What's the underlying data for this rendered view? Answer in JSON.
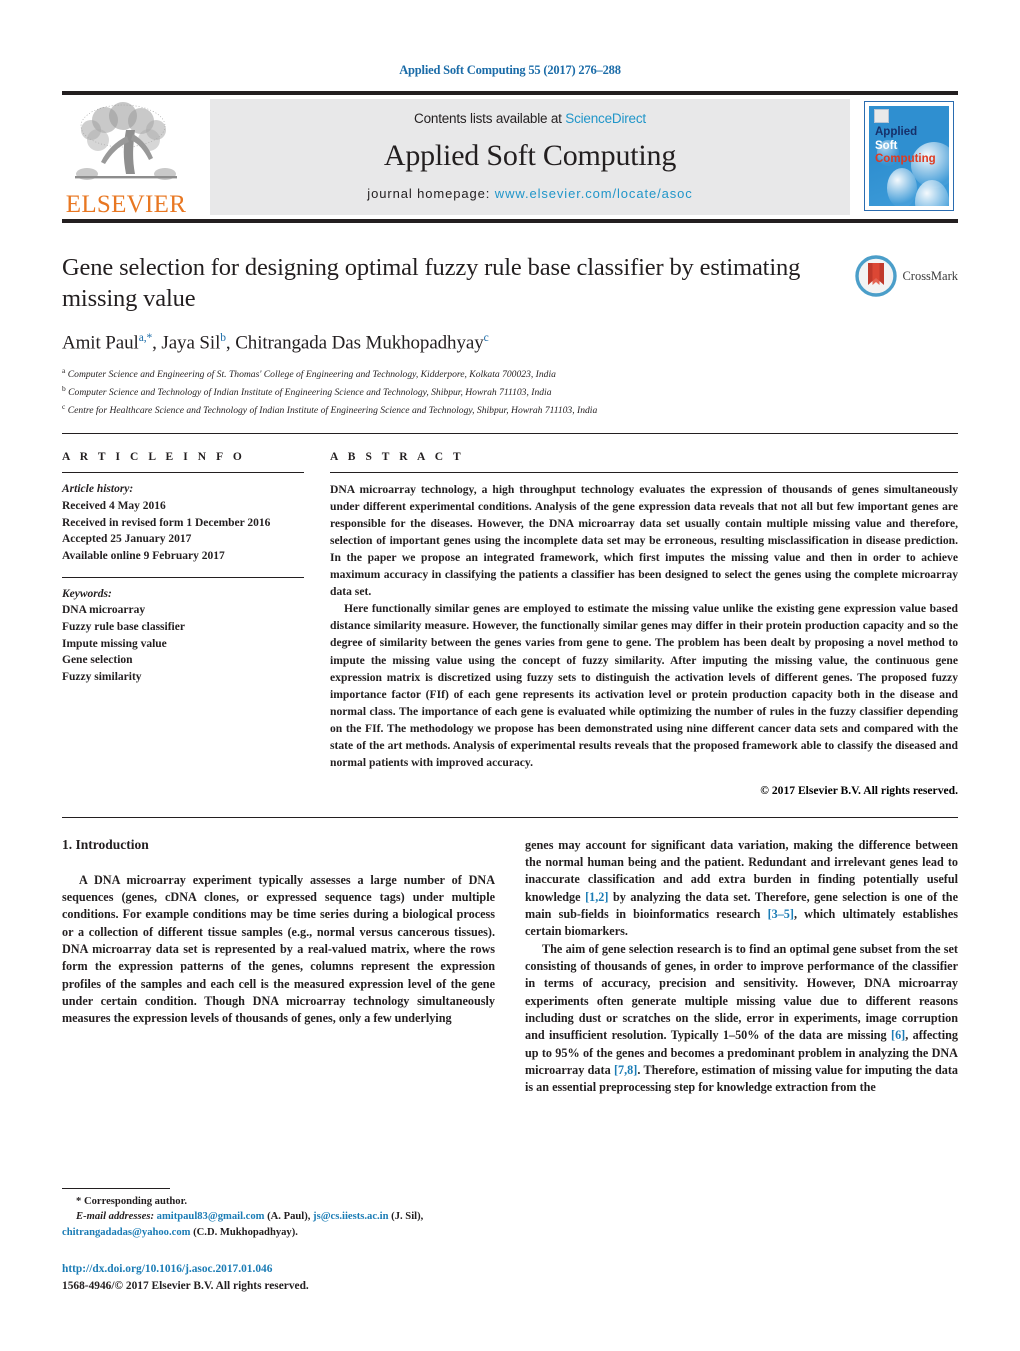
{
  "running_head": "Applied Soft Computing 55 (2017) 276–288",
  "masthead": {
    "publisher": "ELSEVIER",
    "contents_prefix": "Contents lists available at ",
    "contents_link": "ScienceDirect",
    "journal_name": "Applied Soft Computing",
    "homepage_prefix": "journal homepage: ",
    "homepage_url": "www.elsevier.com/locate/asoc",
    "cover": {
      "line1": "Applied",
      "line2": "Soft",
      "line3": "Computing"
    },
    "accent_blue": "#2196c9",
    "elsevier_orange": "#e87722"
  },
  "article": {
    "title": "Gene selection for designing optimal fuzzy rule base classifier by estimating missing value",
    "authors_html": "Amit Paul<sup>a,*</sup>, Jaya Sil<sup>b</sup>, Chitrangada Das Mukhopadhyay<sup>c</sup>",
    "affiliations": [
      {
        "marker": "a",
        "text": "Computer Science and Engineering of St. Thomas' College of Engineering and Technology, Kidderpore, Kolkata 700023, India"
      },
      {
        "marker": "b",
        "text": "Computer Science and Technology of Indian Institute of Engineering Science and Technology, Shibpur, Howrah 711103, India"
      },
      {
        "marker": "c",
        "text": "Centre for Healthcare Science and Technology of Indian Institute of Engineering Science and Technology, Shibpur, Howrah 711103, India"
      }
    ],
    "crossmark_label": "CrossMark"
  },
  "article_info": {
    "heading": "A R T I C L E   I N F O",
    "history_label": "Article history:",
    "history": [
      "Received 4 May 2016",
      "Received in revised form 1 December 2016",
      "Accepted 25 January 2017",
      "Available online 9 February 2017"
    ],
    "keywords_label": "Keywords:",
    "keywords": [
      "DNA microarray",
      "Fuzzy rule base classifier",
      "Impute missing value",
      "Gene selection",
      "Fuzzy similarity"
    ]
  },
  "abstract": {
    "heading": "A B S T R A C T",
    "paragraphs": [
      "DNA microarray technology, a high throughput technology evaluates the expression of thousands of genes simultaneously under different experimental conditions. Analysis of the gene expression data reveals that not all but few important genes are responsible for the diseases. However, the DNA microarray data set usually contain multiple missing value and therefore, selection of important genes using the incomplete data set may be erroneous, resulting misclassification in disease prediction. In the paper we propose an integrated framework, which first imputes the missing value and then in order to achieve maximum accuracy in classifying the patients a classifier has been designed to select the genes using the complete microarray data set.",
      "Here functionally similar genes are employed to estimate the missing value unlike the existing gene expression value based distance similarity measure. However, the functionally similar genes may differ in their protein production capacity and so the degree of similarity between the genes varies from gene to gene. The problem has been dealt by proposing a novel method to impute the missing value using the concept of fuzzy similarity. After imputing the missing value, the continuous gene expression matrix is discretized using fuzzy sets to distinguish the activation levels of different genes. The proposed fuzzy importance factor (FIf) of each gene represents its activation level or protein production capacity both in the disease and normal class. The importance of each gene is evaluated while optimizing the number of rules in the fuzzy classifier depending on the FIf. The methodology we propose has been demonstrated using nine different cancer data sets and compared with the state of the art methods. Analysis of experimental results reveals that the proposed framework able to classify the diseased and normal patients with improved accuracy."
    ],
    "copyright": "© 2017 Elsevier B.V. All rights reserved."
  },
  "body": {
    "section_number_title": "1.  Introduction",
    "left_paragraph": "A DNA microarray experiment typically assesses a large number of DNA sequences (genes, cDNA clones, or expressed sequence tags) under multiple conditions. For example conditions may be time series during a biological process or a collection of different tissue samples (e.g., normal versus cancerous tissues). DNA microarray data set is represented by a real-valued matrix, where the rows form the expression patterns of the genes, columns represent the expression profiles of the samples and each cell is the measured expression level of the gene under certain condition. Though DNA microarray technology simultaneously measures the expression levels of thousands of genes, only a few underlying",
    "right_paragraph_1_part1": "genes may account for significant data variation, making the difference between the normal human being and the patient. Redundant and irrelevant genes lead to inaccurate classification and add extra burden in finding potentially useful knowledge ",
    "right_ref_1": "[1,2]",
    "right_paragraph_1_part2": " by analyzing the data set. Therefore, gene selection is one of the main sub-fields in bioinformatics research ",
    "right_ref_2": "[3–5]",
    "right_paragraph_1_part3": ", which ultimately establishes certain biomarkers.",
    "right_paragraph_2_part1": "The aim of gene selection research is to find an optimal gene subset from the set consisting of thousands of genes, in order to improve performance of the classifier in terms of accuracy, precision and sensitivity. However, DNA microarray experiments often generate multiple missing value due to different reasons including dust or scratches on the slide, error in experiments, image corruption and insufficient resolution. Typically 1–50% of the data are missing ",
    "right_ref_3": "[6]",
    "right_paragraph_2_part2": ", affecting up to 95% of the genes and becomes a predominant problem in analyzing the DNA microarray data ",
    "right_ref_4": "[7,8]",
    "right_paragraph_2_part3": ". Therefore, estimation of missing value for imputing the data is an essential preprocessing step for knowledge extraction from the"
  },
  "footnote": {
    "corresponding": "* Corresponding author.",
    "emails_label": "E-mail addresses:",
    "email_1": "amitpaul83@gmail.com",
    "email_1_owner": " (A. Paul), ",
    "email_2": "js@cs.iiests.ac.in",
    "email_2_owner": " (J. Sil), ",
    "email_3": "chitrangadadas@yahoo.com",
    "email_3_owner": " (C.D. Mukhopadhyay).",
    "doi": "http://dx.doi.org/10.1016/j.asoc.2017.01.046",
    "issn": "1568-4946/© 2017 Elsevier B.V. All rights reserved."
  }
}
